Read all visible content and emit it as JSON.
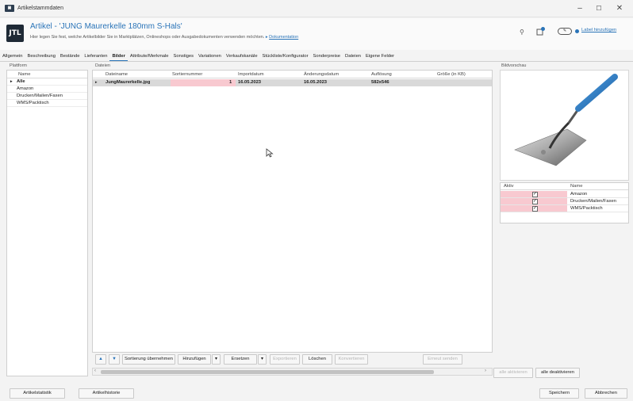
{
  "window": {
    "title": "Artikelstammdaten",
    "min": "–",
    "max": "☐",
    "close": "✕"
  },
  "header": {
    "logo": "JTL",
    "title": "Artikel - 'JUNG Maurerkelle 180mm S-Hals'",
    "subtitle": "Hier legen Sie fest, welche Artikelbilder Sie in Marktplätzen, Onlineshops oder Ausgabedokumenten verwenden möchten.",
    "doc_link": "Dokumentation",
    "label_link": "Label hinzufügen"
  },
  "tabs": [
    "Allgemein",
    "Beschreibung",
    "Bestände",
    "Lieferanten",
    "Bilder",
    "Attribute/Merkmale",
    "Sonstiges",
    "Variationen",
    "Verkaufskanäle",
    "Stückliste/Konfigurator",
    "Sonderpreise",
    "Dateien",
    "Eigene Felder"
  ],
  "active_tab": "Bilder",
  "plattform": {
    "group": "Plattform",
    "header": "Name",
    "items": [
      "Alle",
      "Amazon",
      "Drucken/Mailen/Faxen",
      "WMS/Packtisch"
    ]
  },
  "dateien": {
    "group": "Dateien",
    "columns": [
      "Dateiname",
      "Sortiernummer",
      "Importdatum",
      "Änderungsdatum",
      "Auflösung",
      "Größe (in KB)"
    ],
    "rows": [
      {
        "name": "JungMaurerkelle.jpg",
        "sort": "1",
        "import": "16.05.2023",
        "changed": "16.05.2023",
        "res": "582x546",
        "size": ""
      }
    ]
  },
  "toolbar": {
    "up": "▲",
    "down": "▼",
    "sort": "Sortierung übernehmen",
    "add": "Hinzufügen",
    "replace": "Ersetzen",
    "export": "Exportieren",
    "delete": "Löschen",
    "convert": "Konvertieren",
    "send": "Erneut senden",
    "dropdown": "▾"
  },
  "preview": {
    "group": "Bildvorschau"
  },
  "aktiv": {
    "col_aktiv": "Aktiv",
    "col_name": "Name",
    "rows": [
      "Amazon",
      "Drucken/Mailen/Faxen",
      "WMS/Packtisch"
    ],
    "btn_all_on": "alle aktivieren",
    "btn_all_off": "alle deaktivieren"
  },
  "footer": {
    "stat": "Artikelstatistik",
    "hist": "Artikelhistorie",
    "save": "Speichern",
    "cancel": "Abbrechen"
  },
  "colors": {
    "accent": "#2a74b8",
    "pink": "#f8c9d0",
    "selected_row": "#d9d9d9"
  }
}
